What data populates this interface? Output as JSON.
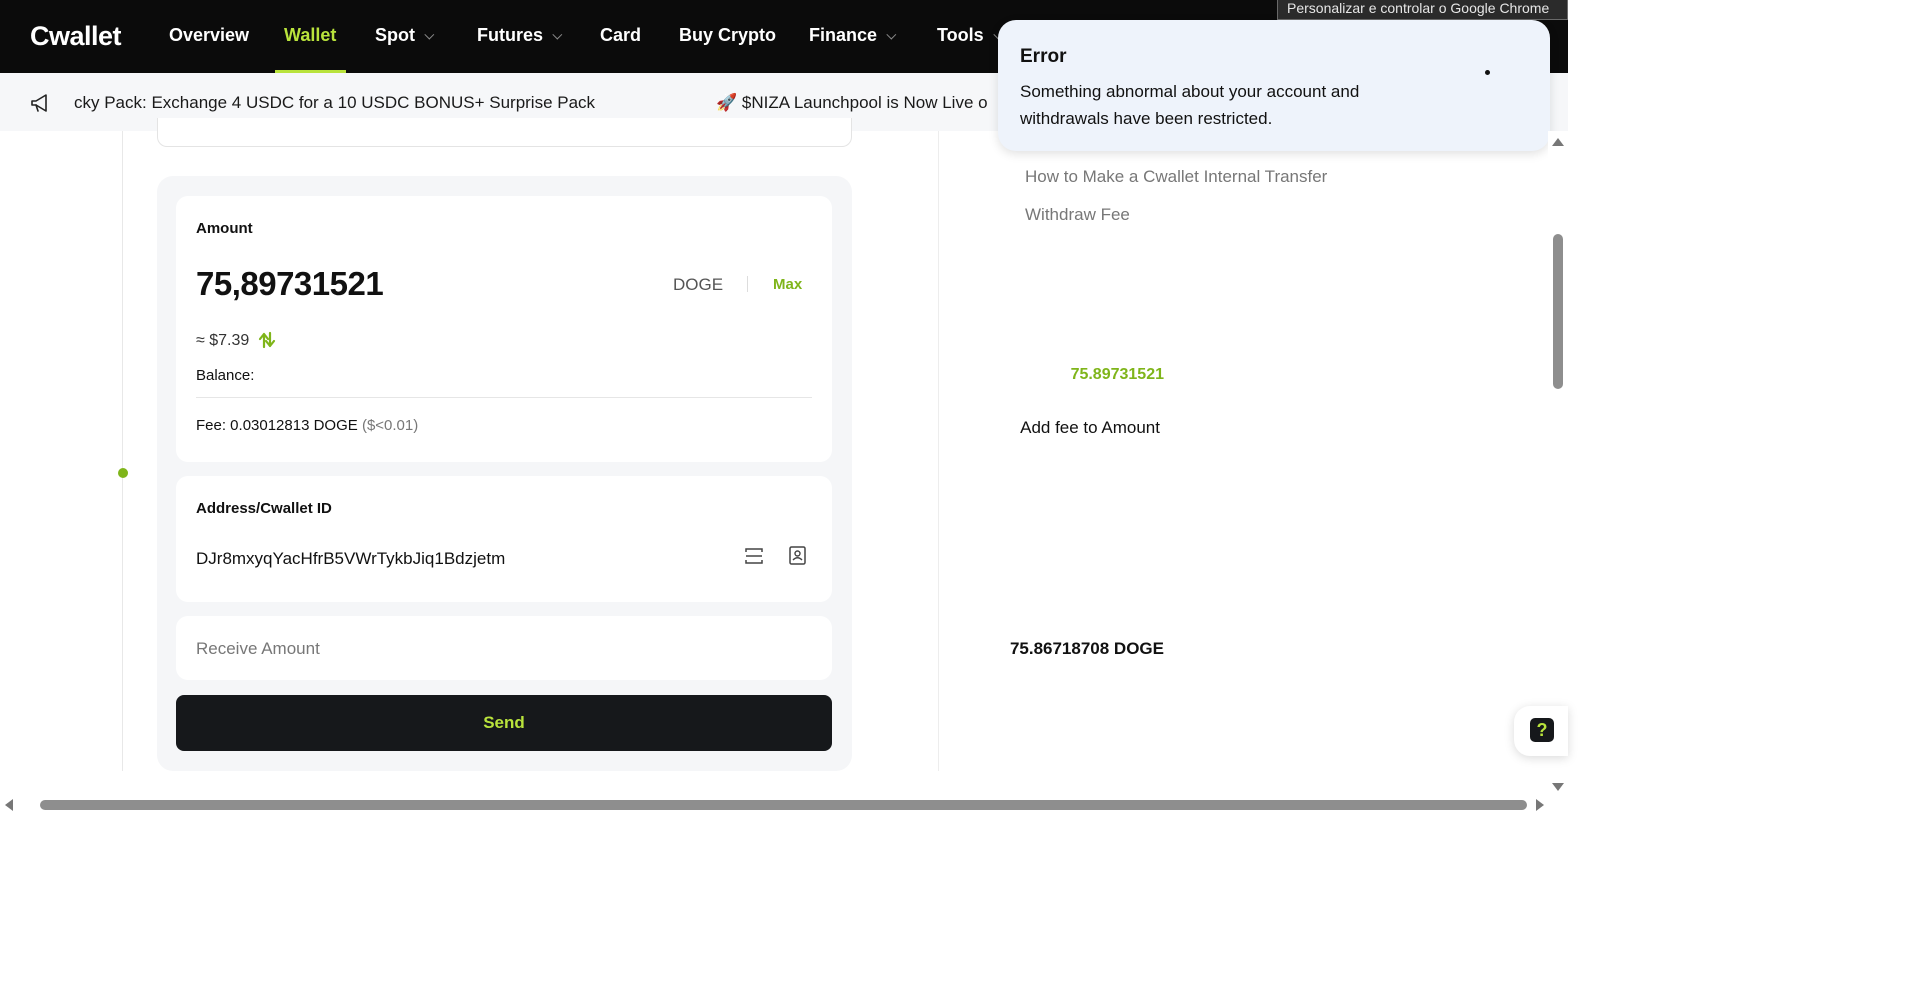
{
  "nav": {
    "logo": "Cwallet",
    "items": [
      {
        "label": "Overview"
      },
      {
        "label": "Wallet",
        "active": true
      },
      {
        "label": "Spot",
        "has_dropdown": true
      },
      {
        "label": "Futures",
        "has_dropdown": true
      },
      {
        "label": "Card"
      },
      {
        "label": "Buy Crypto"
      },
      {
        "label": "Finance",
        "has_dropdown": true
      },
      {
        "label": "Tools",
        "has_dropdown": true
      }
    ],
    "accent_color": "#b9e33c"
  },
  "chrome_tooltip": "Personalizar e controlar o Google Chrome",
  "ticker": {
    "icon": "megaphone-icon",
    "items": [
      "cky Pack: Exchange 4 USDC for a 10 USDC BONUS+ Surprise Pack",
      "🚀 $NIZA Launchpool is Now Live o"
    ]
  },
  "withdraw_form": {
    "amount_label": "Amount",
    "amount_value": "75,89731521",
    "currency": "DOGE",
    "max_label": "Max",
    "usd_approx": "≈ $7.39",
    "balance_label": "Balance:",
    "balance_value": "75.89731521",
    "fee_label": "Fee: 0.03012813 DOGE",
    "fee_usd": "($<0.01)",
    "add_fee_label": "Add fee to Amount",
    "address_label": "Address/Cwallet ID",
    "address_value": "DJr8mxyqYacHfrB5VWrTykbJiq1Bdzjetm",
    "receive_label": "Receive Amount",
    "receive_value": "75.86718708 DOGE",
    "send_label": "Send"
  },
  "help_links": [
    "How to Make a Cwallet Internal Transfer",
    "Withdraw Fee"
  ],
  "toast": {
    "title": "Error",
    "message": "Something abnormal about your account and withdrawals have been restricted."
  },
  "help_fab": "?"
}
